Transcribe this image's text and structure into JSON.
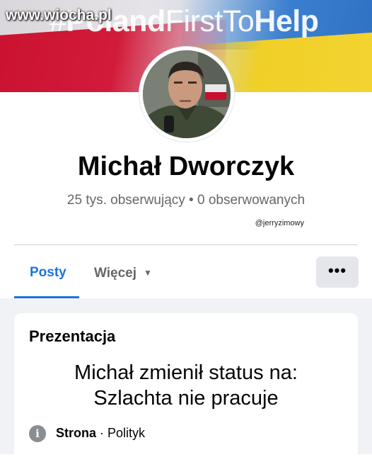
{
  "watermark": "www.wiocha.pl",
  "cover": {
    "hashtag_regular_a": "#",
    "hashtag_bold_a": "Poland",
    "hashtag_regular_b": "FirstTo",
    "hashtag_bold_b": "Help",
    "colors": {
      "red": "#c9102f",
      "yellow": "#f0cf28",
      "blue": "#3a7fcf"
    }
  },
  "profile": {
    "name": "Michał Dworczyk",
    "followers": "25 tys. obserwujący • 0 obserwowanych",
    "credit": "@jerryzimowy"
  },
  "tabs": {
    "posts": "Posty",
    "more": "Więcej",
    "more_icon": "caret-down-icon",
    "options_label": "•••",
    "active_color": "#1b74e4"
  },
  "card": {
    "title": "Prezentacja",
    "status_line1": "Michał zmienił status na:",
    "status_line2": "Szlachta nie pracuje",
    "info_icon": "i",
    "info_type": "Strona",
    "info_separator": " · ",
    "info_category": "Polityk"
  }
}
